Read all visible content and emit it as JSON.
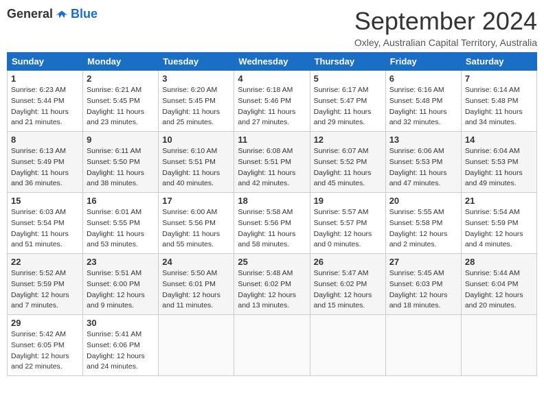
{
  "logo": {
    "general": "General",
    "blue": "Blue"
  },
  "title": "September 2024",
  "subtitle": "Oxley, Australian Capital Territory, Australia",
  "days": [
    "Sunday",
    "Monday",
    "Tuesday",
    "Wednesday",
    "Thursday",
    "Friday",
    "Saturday"
  ],
  "weeks": [
    [
      {
        "day": "1",
        "sunrise": "6:23 AM",
        "sunset": "5:44 PM",
        "daylight": "11 hours and 21 minutes."
      },
      {
        "day": "2",
        "sunrise": "6:21 AM",
        "sunset": "5:45 PM",
        "daylight": "11 hours and 23 minutes."
      },
      {
        "day": "3",
        "sunrise": "6:20 AM",
        "sunset": "5:45 PM",
        "daylight": "11 hours and 25 minutes."
      },
      {
        "day": "4",
        "sunrise": "6:18 AM",
        "sunset": "5:46 PM",
        "daylight": "11 hours and 27 minutes."
      },
      {
        "day": "5",
        "sunrise": "6:17 AM",
        "sunset": "5:47 PM",
        "daylight": "11 hours and 29 minutes."
      },
      {
        "day": "6",
        "sunrise": "6:16 AM",
        "sunset": "5:48 PM",
        "daylight": "11 hours and 32 minutes."
      },
      {
        "day": "7",
        "sunrise": "6:14 AM",
        "sunset": "5:48 PM",
        "daylight": "11 hours and 34 minutes."
      }
    ],
    [
      {
        "day": "8",
        "sunrise": "6:13 AM",
        "sunset": "5:49 PM",
        "daylight": "11 hours and 36 minutes."
      },
      {
        "day": "9",
        "sunrise": "6:11 AM",
        "sunset": "5:50 PM",
        "daylight": "11 hours and 38 minutes."
      },
      {
        "day": "10",
        "sunrise": "6:10 AM",
        "sunset": "5:51 PM",
        "daylight": "11 hours and 40 minutes."
      },
      {
        "day": "11",
        "sunrise": "6:08 AM",
        "sunset": "5:51 PM",
        "daylight": "11 hours and 42 minutes."
      },
      {
        "day": "12",
        "sunrise": "6:07 AM",
        "sunset": "5:52 PM",
        "daylight": "11 hours and 45 minutes."
      },
      {
        "day": "13",
        "sunrise": "6:06 AM",
        "sunset": "5:53 PM",
        "daylight": "11 hours and 47 minutes."
      },
      {
        "day": "14",
        "sunrise": "6:04 AM",
        "sunset": "5:53 PM",
        "daylight": "11 hours and 49 minutes."
      }
    ],
    [
      {
        "day": "15",
        "sunrise": "6:03 AM",
        "sunset": "5:54 PM",
        "daylight": "11 hours and 51 minutes."
      },
      {
        "day": "16",
        "sunrise": "6:01 AM",
        "sunset": "5:55 PM",
        "daylight": "11 hours and 53 minutes."
      },
      {
        "day": "17",
        "sunrise": "6:00 AM",
        "sunset": "5:56 PM",
        "daylight": "11 hours and 55 minutes."
      },
      {
        "day": "18",
        "sunrise": "5:58 AM",
        "sunset": "5:56 PM",
        "daylight": "11 hours and 58 minutes."
      },
      {
        "day": "19",
        "sunrise": "5:57 AM",
        "sunset": "5:57 PM",
        "daylight": "12 hours and 0 minutes."
      },
      {
        "day": "20",
        "sunrise": "5:55 AM",
        "sunset": "5:58 PM",
        "daylight": "12 hours and 2 minutes."
      },
      {
        "day": "21",
        "sunrise": "5:54 AM",
        "sunset": "5:59 PM",
        "daylight": "12 hours and 4 minutes."
      }
    ],
    [
      {
        "day": "22",
        "sunrise": "5:52 AM",
        "sunset": "5:59 PM",
        "daylight": "12 hours and 7 minutes."
      },
      {
        "day": "23",
        "sunrise": "5:51 AM",
        "sunset": "6:00 PM",
        "daylight": "12 hours and 9 minutes."
      },
      {
        "day": "24",
        "sunrise": "5:50 AM",
        "sunset": "6:01 PM",
        "daylight": "12 hours and 11 minutes."
      },
      {
        "day": "25",
        "sunrise": "5:48 AM",
        "sunset": "6:02 PM",
        "daylight": "12 hours and 13 minutes."
      },
      {
        "day": "26",
        "sunrise": "5:47 AM",
        "sunset": "6:02 PM",
        "daylight": "12 hours and 15 minutes."
      },
      {
        "day": "27",
        "sunrise": "5:45 AM",
        "sunset": "6:03 PM",
        "daylight": "12 hours and 18 minutes."
      },
      {
        "day": "28",
        "sunrise": "5:44 AM",
        "sunset": "6:04 PM",
        "daylight": "12 hours and 20 minutes."
      }
    ],
    [
      {
        "day": "29",
        "sunrise": "5:42 AM",
        "sunset": "6:05 PM",
        "daylight": "12 hours and 22 minutes."
      },
      {
        "day": "30",
        "sunrise": "5:41 AM",
        "sunset": "6:06 PM",
        "daylight": "12 hours and 24 minutes."
      },
      null,
      null,
      null,
      null,
      null
    ]
  ],
  "labels": {
    "sunrise": "Sunrise: ",
    "sunset": "Sunset: ",
    "daylight": "Daylight: "
  }
}
